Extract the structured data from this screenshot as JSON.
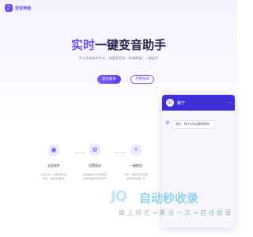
{
  "header": {
    "logo_glyph": "♪",
    "brand": "变音神器"
  },
  "hero": {
    "title_accent": "实时",
    "title_rest": "一键变音助手",
    "subtitle": "声卡音效软件平台，海量语音包，原唱降噪，一键变声",
    "primary_button": "前往版本",
    "secondary_button": "完整版本"
  },
  "features": [
    {
      "icon": "shield-icon",
      "glyph": "◉",
      "title": "全局软件",
      "desc": [
        "全局生效，支持所有软件",
        "游戏、直播全面兼容"
      ]
    },
    {
      "icon": "gear-icon",
      "glyph": "⚙",
      "title": "设置驱动",
      "desc": [
        "驱动兼容声卡自动配置",
        "智能识别输出通道调节"
      ]
    },
    {
      "icon": "bolt-icon",
      "glyph": "⚡",
      "title": "一键使用",
      "desc": [
        "开启一键变声即可使用",
        "操作简单快速上手"
      ]
    }
  ],
  "chat": {
    "avatar_glyph": "☺",
    "agent_name": "静宁",
    "minimize_glyph": "–",
    "message": "您好，有什么可以帮您的吗？",
    "message_avatar_glyph": "☺"
  },
  "watermark": {
    "logo": "JQ",
    "title": "自动秒收录",
    "slogan": "做 上 排 名 → 来 访 一 次 → 自 动 收 录"
  },
  "colors": {
    "accent": "#6a4cf0",
    "chat_header": "#3f2fd6"
  }
}
